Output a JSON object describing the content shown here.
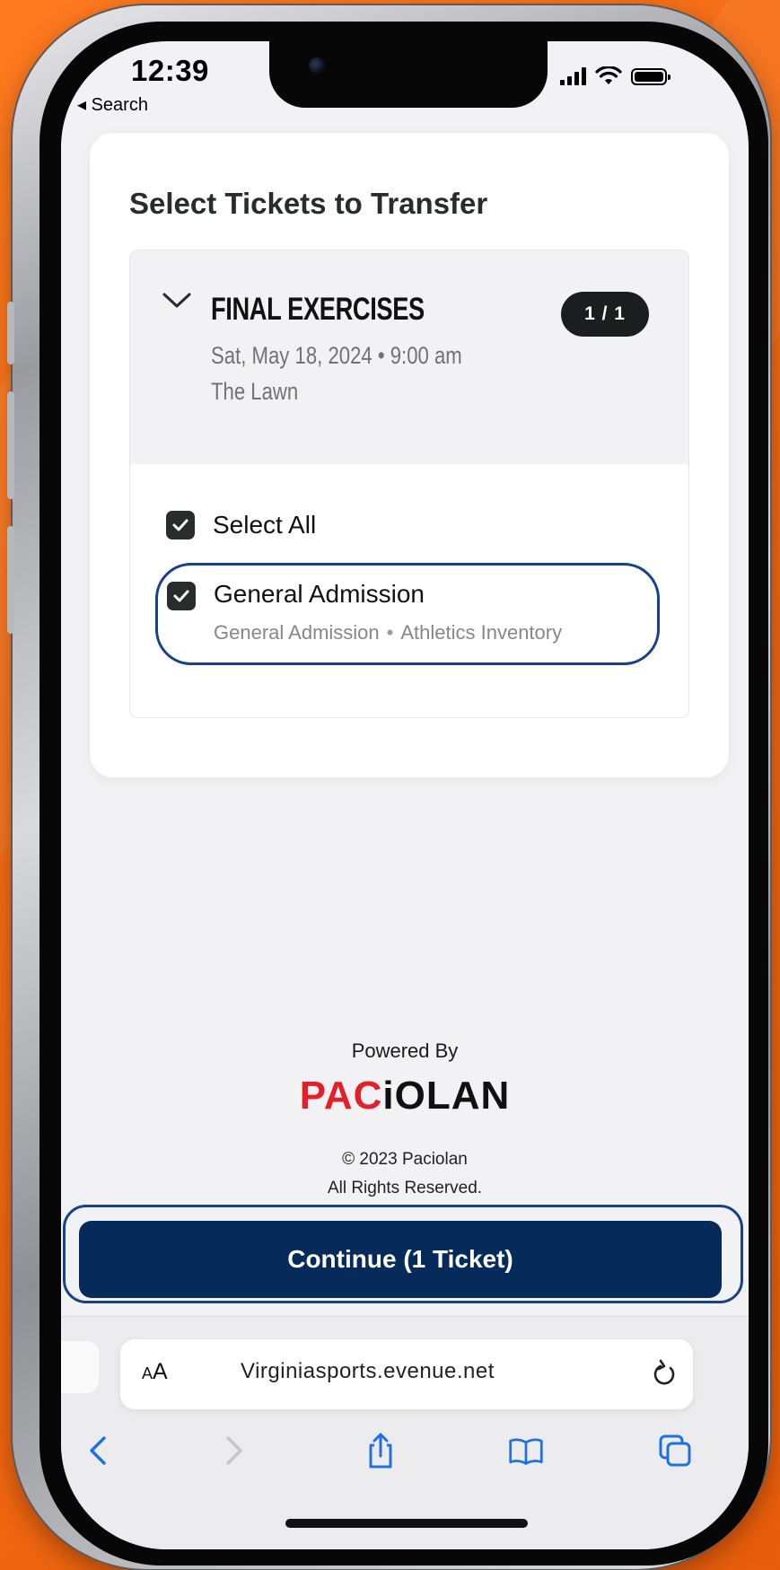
{
  "status_bar": {
    "time": "12:39",
    "back_label": "◂ Search"
  },
  "page": {
    "title": "Select Tickets to Transfer"
  },
  "event": {
    "name": "FINAL EXERCISES",
    "date_time": "Sat, May 18, 2024 • 9:00 am",
    "venue": "The Lawn",
    "ticket_count": "1 / 1",
    "expanded": true
  },
  "selection": {
    "select_all_label": "Select All",
    "select_all_checked": true,
    "tickets": [
      {
        "title": "General Admission",
        "section": "General Admission",
        "inventory": "Athletics Inventory",
        "checked": true
      }
    ]
  },
  "footer": {
    "powered_by": "Powered By",
    "logo_red": "PAC",
    "logo_dark": "iOLAN",
    "copyright_line1": "© 2023 Paciolan",
    "copyright_line2": "All Rights Reserved."
  },
  "actions": {
    "continue_label": "Continue (1 Ticket)"
  },
  "browser": {
    "text_size_label_small": "A",
    "text_size_label_large": "A",
    "url": "Virginiasports.evenue.net"
  },
  "colors": {
    "background_orange": "#f36a12",
    "primary_navy": "#062b5a",
    "highlight_blue": "#17408d",
    "brand_red": "#e32027"
  }
}
